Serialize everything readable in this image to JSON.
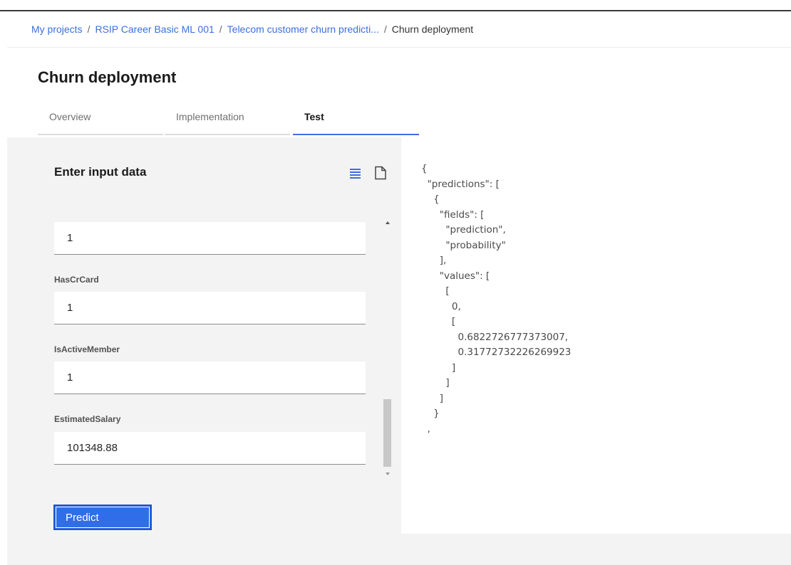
{
  "breadcrumb": {
    "items": [
      "My projects",
      "RSIP Career Basic ML 001",
      "Telecom customer churn predicti..."
    ],
    "separator": "/",
    "current": "Churn deployment"
  },
  "page": {
    "title": "Churn deployment"
  },
  "tabs": [
    {
      "label": "Overview",
      "active": false
    },
    {
      "label": "Implementation",
      "active": false
    },
    {
      "label": "Test",
      "active": true
    }
  ],
  "input_panel": {
    "title": "Enter input data",
    "view_icons": [
      "list-view-icon",
      "file-view-icon"
    ],
    "fields": [
      {
        "label": "",
        "value": "1"
      },
      {
        "label": "HasCrCard",
        "value": "1"
      },
      {
        "label": "IsActiveMember",
        "value": "1"
      },
      {
        "label": "EstimatedSalary",
        "value": "101348.88"
      }
    ],
    "predict_label": "Predict"
  },
  "output": {
    "json": "{\n  \"predictions\": [\n    {\n      \"fields\": [\n        \"prediction\",\n        \"probability\"\n      ],\n      \"values\": [\n        [\n          0,\n          [\n            0.6822726777373007,\n            0.31772732226269923\n          ]\n        ]\n      ]\n    }\n  ,"
  },
  "colors": {
    "accent": "#3d70e0",
    "button": "#2f6ee8",
    "link": "#3a6fe0",
    "panel_bg": "#f3f3f3"
  }
}
